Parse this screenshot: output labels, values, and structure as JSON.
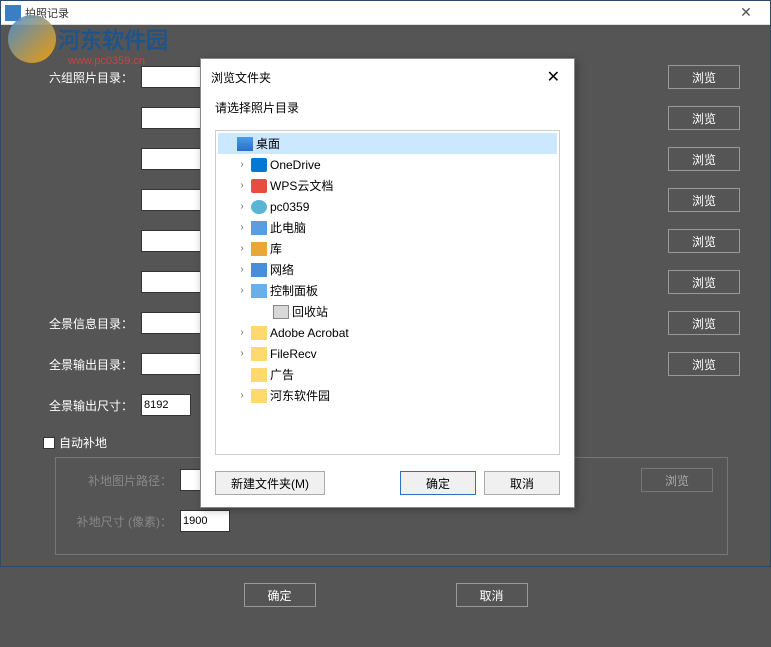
{
  "titlebar": {
    "title": "拍照记录"
  },
  "watermark": {
    "text1": "河东软件园",
    "text2": "www.pc0359.cn"
  },
  "labels": {
    "six_group": "六组照片目录：",
    "pano_info": "全景信息目录：",
    "pano_out": "全景输出目录：",
    "pano_size": "全景输出尺寸：",
    "auto_ground": "自动补地",
    "ground_img": "补地图片路径：",
    "ground_size": "补地尺寸 (像素)：",
    "browse": "浏览",
    "ok": "确定",
    "cancel": "取消"
  },
  "values": {
    "pano_size": "8192",
    "ground_size": "1900"
  },
  "dialog": {
    "title": "浏览文件夹",
    "prompt": "请选择照片目录",
    "new_folder": "新建文件夹(M)",
    "ok": "确定",
    "cancel": "取消",
    "tree": [
      {
        "label": "桌面",
        "icon": "desktop",
        "indent": 0,
        "expand": "",
        "selected": true
      },
      {
        "label": "OneDrive",
        "icon": "onedrive",
        "indent": 1,
        "expand": "›"
      },
      {
        "label": "WPS云文档",
        "icon": "wps",
        "indent": 1,
        "expand": "›"
      },
      {
        "label": "pc0359",
        "icon": "user",
        "indent": 1,
        "expand": "›"
      },
      {
        "label": "此电脑",
        "icon": "pc",
        "indent": 1,
        "expand": "›"
      },
      {
        "label": "库",
        "icon": "lib",
        "indent": 1,
        "expand": "›"
      },
      {
        "label": "网络",
        "icon": "net",
        "indent": 1,
        "expand": "›"
      },
      {
        "label": "控制面板",
        "icon": "cpanel",
        "indent": 1,
        "expand": "›"
      },
      {
        "label": "回收站",
        "icon": "recycle",
        "indent": 2,
        "expand": ""
      },
      {
        "label": "Adobe Acrobat",
        "icon": "folder",
        "indent": 1,
        "expand": "›"
      },
      {
        "label": "FileRecv",
        "icon": "folder",
        "indent": 1,
        "expand": "›"
      },
      {
        "label": "广告",
        "icon": "folder",
        "indent": 1,
        "expand": ""
      },
      {
        "label": "河东软件园",
        "icon": "folder",
        "indent": 1,
        "expand": "›"
      }
    ]
  }
}
